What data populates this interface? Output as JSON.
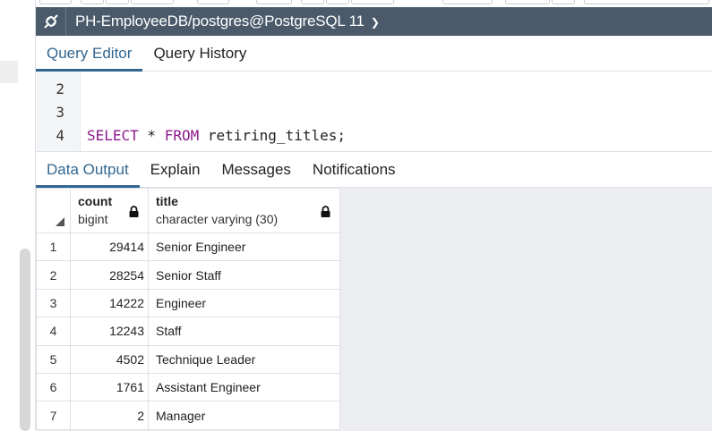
{
  "connection": {
    "title": "PH-EmployeeDB/postgres@PostgreSQL 11",
    "icon": "connection-plug-icon",
    "caret_icon": "chevron-down-icon"
  },
  "editor_tabs": [
    {
      "label": "Query Editor",
      "active": true
    },
    {
      "label": "Query History",
      "active": false
    }
  ],
  "editor": {
    "lines": [
      {
        "number": "2",
        "code": ""
      },
      {
        "number": "3",
        "code": ""
      },
      {
        "number": "4",
        "kw1": "SELECT",
        "mid": " * ",
        "kw2": "FROM",
        "rest": " retiring_titles;"
      }
    ]
  },
  "output_tabs": [
    {
      "label": "Data Output",
      "active": true
    },
    {
      "label": "Explain",
      "active": false
    },
    {
      "label": "Messages",
      "active": false
    },
    {
      "label": "Notifications",
      "active": false
    }
  ],
  "grid": {
    "columns": [
      {
        "name": "count",
        "type": "bigint",
        "icon": "lock-icon"
      },
      {
        "name": "title",
        "type": "character varying (30)",
        "icon": "lock-icon"
      }
    ],
    "rows": [
      {
        "n": "1",
        "count": "29414",
        "title": "Senior Engineer"
      },
      {
        "n": "2",
        "count": "28254",
        "title": "Senior Staff"
      },
      {
        "n": "3",
        "count": "14222",
        "title": "Engineer"
      },
      {
        "n": "4",
        "count": "12243",
        "title": "Staff"
      },
      {
        "n": "5",
        "count": "4502",
        "title": "Technique Leader"
      },
      {
        "n": "6",
        "count": "1761",
        "title": "Assistant Engineer"
      },
      {
        "n": "7",
        "count": "2",
        "title": "Manager"
      }
    ]
  },
  "colors": {
    "accent": "#326690",
    "conn_bar": "#4a5a6b",
    "keyword": "#8b1a8b"
  }
}
